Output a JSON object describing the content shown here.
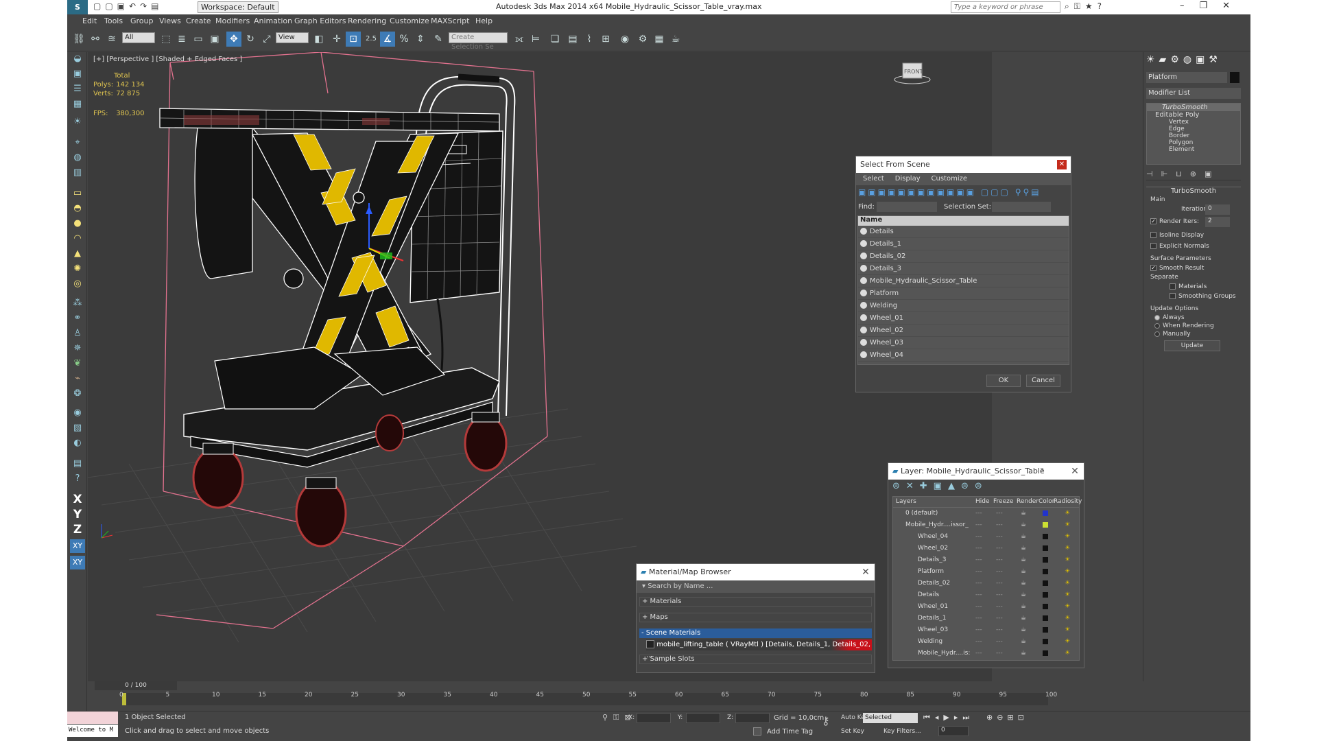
{
  "app": {
    "title": "Autodesk 3ds Max  2014 x64     Mobile_Hydraulic_Scissor_Table_vray.max",
    "workspace": "Workspace: Default",
    "search_placeholder": "Type a keyword or phrase",
    "logo": "3ds Max"
  },
  "menu": [
    "Edit",
    "Tools",
    "Group",
    "Views",
    "Create",
    "Modifiers",
    "Animation",
    "Graph Editors",
    "Rendering",
    "Customize",
    "MAXScript",
    "Help"
  ],
  "toolbar": {
    "selection_filter": "All",
    "ref_coord": "View",
    "selection_set_placeholder": "Create Selection Se",
    "snap_label": "2.5"
  },
  "viewport": {
    "label": "[+] [Perspective ] [Shaded + Edged Faces ]",
    "stats": {
      "total_label": "Total",
      "polys_label": "Polys:",
      "polys": "142 134",
      "verts_label": "Verts:",
      "verts": "72 875",
      "fps_label": "FPS:",
      "fps": "380,300"
    },
    "viewcube": "FRONT"
  },
  "select_from_scene": {
    "title": "Select From Scene",
    "menus": [
      "Select",
      "Display",
      "Customize"
    ],
    "find_label": "Find:",
    "selection_set_label": "Selection Set:",
    "column_name": "Name",
    "items": [
      "Details",
      "Details_1",
      "Details_02",
      "Details_3",
      "Mobile_Hydraulic_Scissor_Table",
      "Platform",
      "Welding",
      "Wheel_01",
      "Wheel_02",
      "Wheel_03",
      "Wheel_04"
    ],
    "ok": "OK",
    "cancel": "Cancel"
  },
  "layer_dialog": {
    "title": "Layer: Mobile_Hydraulic_Scissor_Table",
    "help": "?",
    "columns": [
      "Layers",
      "Hide",
      "Freeze",
      "Render",
      "Color",
      "Radiosity"
    ],
    "rows": [
      {
        "name": "0 (default)",
        "indent": 0,
        "color": "#2233cc"
      },
      {
        "name": "Mobile_Hydr....issor_",
        "indent": 0,
        "color": "#cce033"
      },
      {
        "name": "Wheel_04",
        "indent": 1,
        "color": "#111111"
      },
      {
        "name": "Wheel_02",
        "indent": 1,
        "color": "#111111"
      },
      {
        "name": "Details_3",
        "indent": 1,
        "color": "#111111"
      },
      {
        "name": "Platform",
        "indent": 1,
        "color": "#111111"
      },
      {
        "name": "Details_02",
        "indent": 1,
        "color": "#111111"
      },
      {
        "name": "Details",
        "indent": 1,
        "color": "#111111"
      },
      {
        "name": "Wheel_01",
        "indent": 1,
        "color": "#111111"
      },
      {
        "name": "Details_1",
        "indent": 1,
        "color": "#111111"
      },
      {
        "name": "Wheel_03",
        "indent": 1,
        "color": "#111111"
      },
      {
        "name": "Welding",
        "indent": 1,
        "color": "#111111"
      },
      {
        "name": "Mobile_Hydr....is:",
        "indent": 1,
        "color": "#111111"
      }
    ]
  },
  "material_browser": {
    "title": "Material/Map Browser",
    "search_placeholder": "Search by Name ...",
    "sections": [
      "+ Materials",
      "+ Maps",
      "- Scene Materials"
    ],
    "scene_material": "mobile_lifting_table  ( VRayMtl )  [Details, Details_1, Details_02, ...",
    "sample_slots": "+ Sample Slots"
  },
  "command_panel": {
    "object_name": "Platform",
    "modifier_list": "Modifier List",
    "stack": [
      "TurboSmooth",
      "Editable Poly",
      "Vertex",
      "Edge",
      "Border",
      "Polygon",
      "Element"
    ],
    "rollout_title": "TurboSmooth",
    "main_label": "Main",
    "iterations_label": "Iterations:",
    "iterations": "0",
    "render_iters_label": "Render Iters:",
    "render_iters": "2",
    "isoline": "Isoline Display",
    "explicit_normals": "Explicit Normals",
    "surface_params": "Surface Parameters",
    "smooth_result": "Smooth Result",
    "separate": "Separate",
    "materials": "Materials",
    "smoothing_groups": "Smoothing Groups",
    "update_options": "Update Options",
    "always": "Always",
    "when_rendering": "When Rendering",
    "manually": "Manually",
    "update_btn": "Update"
  },
  "timeline": {
    "frame": "0 / 100",
    "ticks": [
      "0",
      "5",
      "10",
      "15",
      "20",
      "25",
      "30",
      "35",
      "40",
      "45",
      "50",
      "55",
      "60",
      "65",
      "70",
      "75",
      "80",
      "85",
      "90",
      "95",
      "100"
    ]
  },
  "status": {
    "script_listener": "Welcome to M",
    "selected": "1 Object Selected",
    "prompt": "Click and drag to select and move objects",
    "x_label": "X:",
    "y_label": "Y:",
    "z_label": "Z:",
    "grid": "Grid = 10,0cm",
    "add_time_tag": "Add Time Tag",
    "auto_key": "Auto Key",
    "auto_key_value": "Selected",
    "set_key": "Set Key",
    "key_filters": "Key Filters...",
    "frame_field": "0"
  },
  "colors": {
    "accent": "#3e7bb6",
    "yellow": "#e0b800",
    "wire": "#ffffff",
    "bbox": "#e3728f"
  }
}
